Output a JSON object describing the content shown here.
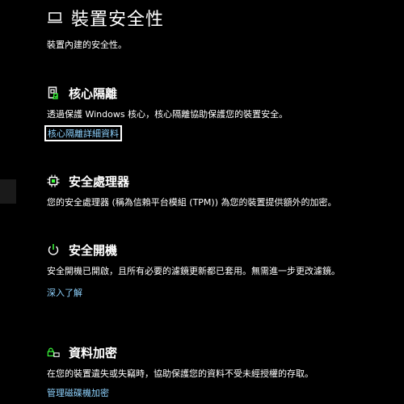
{
  "page": {
    "title": "裝置安全性",
    "subtitle": "裝置內建的安全性。",
    "icon": "laptop-icon"
  },
  "sections": [
    {
      "id": "core-isolation",
      "icon": "core-isolation-icon",
      "title": "核心隔離",
      "description": "透過保護 Windows 核心，核心隔離協助保護您的裝置安全。",
      "link": "核心隔離詳細資料"
    },
    {
      "id": "security-processor",
      "icon": "chip-icon",
      "title": "安全處理器",
      "description": "您的安全處理器 (稱為信賴平台模組 (TPM)) 為您的裝置提供額外的加密。"
    },
    {
      "id": "secure-boot",
      "icon": "power-icon",
      "title": "安全開機",
      "description": "安全開機已開啟，且所有必要的濾鏡更新都已套用。無需進一步更改濾鏡。",
      "link": "深入了解"
    },
    {
      "id": "data-encryption",
      "icon": "lock-icon",
      "title": "資料加密",
      "description": "在您的裝置遺失或失竊時，協助保護您的資料不受未經授權的存取。",
      "link": "管理磁碟機加密"
    }
  ],
  "colors": {
    "background": "#000000",
    "text": "#ffffff",
    "link": "#8fd3ff",
    "icon_accent": "#3cff3c"
  }
}
